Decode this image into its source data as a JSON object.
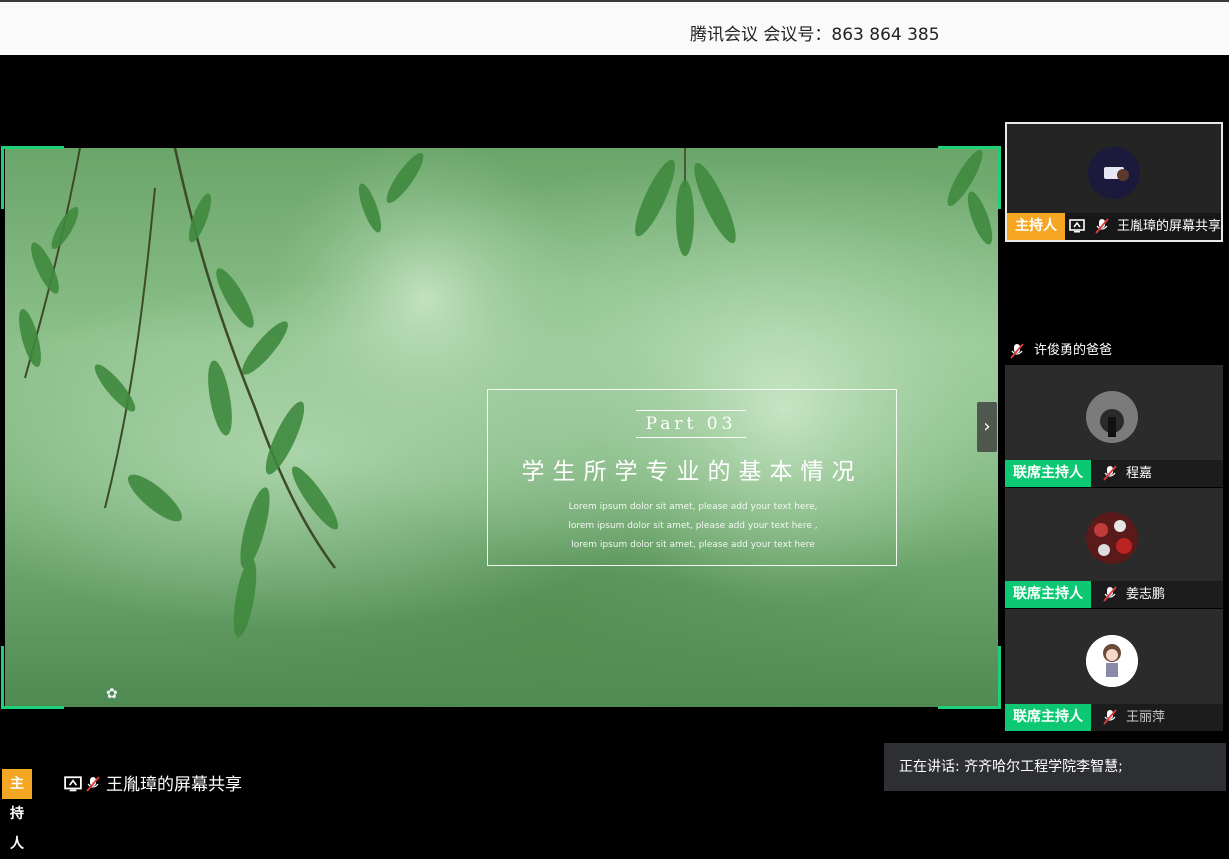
{
  "window": {
    "title": "腾讯会议 会议号：863 864 385"
  },
  "slide": {
    "part": "Part 03",
    "title": "学生所学专业的基本情况",
    "lorem": "Lorem ipsum dolor sit amet, please add your text here, lorem ipsum dolor sit amet, please add your text here , lorem ipsum dolor sit amet, please add your text here"
  },
  "participants": {
    "main_tile": {
      "badge": "主持人",
      "name": "王胤璋的屏幕共享"
    },
    "xu": {
      "name": "许俊勇的爸爸"
    },
    "tiles": [
      {
        "badge": "联席主持人",
        "name": "程嘉"
      },
      {
        "badge": "联席主持人",
        "name": "姜志鹏"
      },
      {
        "badge": "联席主持人",
        "name": "王丽萍"
      }
    ]
  },
  "speaking": {
    "text": "正在讲话: 齐齐哈尔工程学院李智慧;"
  },
  "bottom": {
    "badge": "主持人",
    "name": "王胤璋的屏幕共享"
  },
  "colors": {
    "host": "#f5a623",
    "cohost": "#0cc873",
    "frame": "#1fd07a"
  }
}
